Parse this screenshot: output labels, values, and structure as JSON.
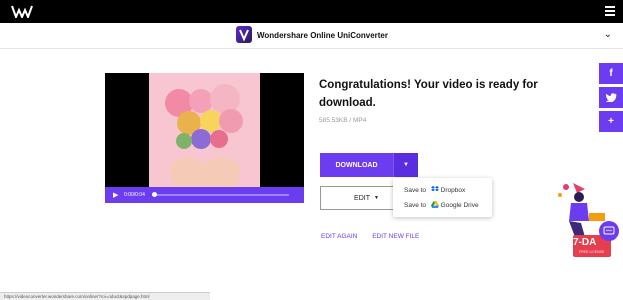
{
  "header": {
    "app_title": "Wondershare Online UniConverter"
  },
  "player": {
    "time": "0:00/0:04"
  },
  "result": {
    "heading": "Congratulations! Your video is ready for download.",
    "meta": "585.53KB / MP4"
  },
  "actions": {
    "download_label": "DOWNLOAD",
    "edit_label": "EDIT",
    "edit_again": "EDIT AGAIN",
    "edit_new_file": "EDIT NEW FILE"
  },
  "save_menu": {
    "items": [
      {
        "label": "Save to",
        "service": "Dropbox"
      },
      {
        "label": "Save to",
        "service": "Google Drive"
      }
    ]
  },
  "social": {
    "items": [
      "facebook-icon",
      "twitter-icon",
      "plus-icon"
    ]
  },
  "promo": {
    "badge": "7-DA",
    "subtext": "FREE LICENSE"
  },
  "status_bar": {
    "url": "https://videoconverter.wondershare.com/online/?roi=oduct&spdpage.html"
  },
  "colors": {
    "accent": "#6b3cf0",
    "topbar": "#000000"
  }
}
